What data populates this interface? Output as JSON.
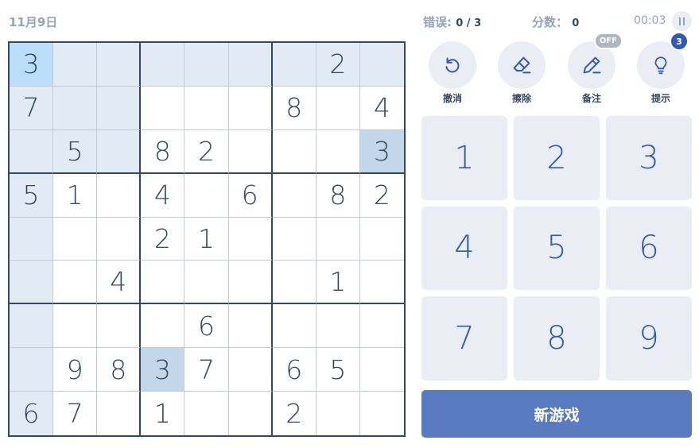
{
  "header": {
    "date": "11月9日",
    "errors_label": "错误:",
    "errors_value": "0 / 3",
    "score_label": "分数：",
    "score_value": "0",
    "timer": "00:03"
  },
  "board": [
    [
      "3",
      "",
      "",
      "",
      "",
      "",
      "",
      "2",
      ""
    ],
    [
      "7",
      "",
      "",
      "",
      "",
      "",
      "8",
      "",
      "4"
    ],
    [
      "",
      "5",
      "",
      "8",
      "2",
      "",
      "",
      "",
      "3"
    ],
    [
      "5",
      "1",
      "",
      "4",
      "",
      "6",
      "",
      "8",
      "2"
    ],
    [
      "",
      "",
      "",
      "2",
      "1",
      "",
      "",
      "",
      ""
    ],
    [
      "",
      "",
      "4",
      "",
      "",
      "",
      "",
      "1",
      ""
    ],
    [
      "",
      "",
      "",
      "",
      "6",
      "",
      "",
      "",
      ""
    ],
    [
      "",
      "9",
      "8",
      "3",
      "7",
      "",
      "6",
      "5",
      ""
    ],
    [
      "6",
      "7",
      "",
      "1",
      "",
      "",
      "2",
      "",
      ""
    ]
  ],
  "selected_cell": [
    0,
    0
  ],
  "tools": {
    "undo": "撤消",
    "erase": "擦除",
    "notes": "备注",
    "notes_state": "OFF",
    "hint": "提示",
    "hint_count": "3"
  },
  "numpad": [
    "1",
    "2",
    "3",
    "4",
    "5",
    "6",
    "7",
    "8",
    "9"
  ],
  "new_game_label": "新游戏"
}
